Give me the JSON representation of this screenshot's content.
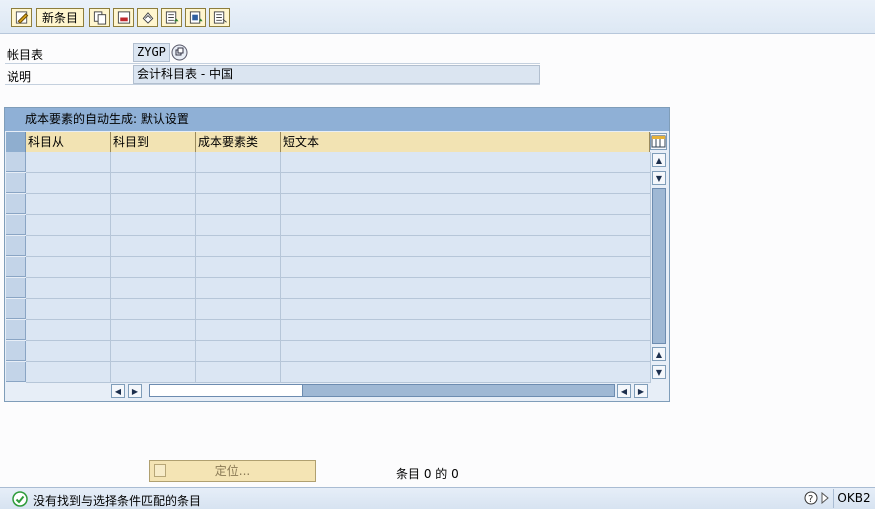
{
  "toolbar": {
    "new_entries_label": "新条目",
    "icons": [
      "edit-toggle-icon",
      "copy-icon",
      "delete-icon",
      "undo-icon",
      "select-all-icon",
      "select-block-icon",
      "deselect-all-icon"
    ]
  },
  "header": {
    "coa_label": "帐目表",
    "coa_value": "ZYGP",
    "desc_label": "说明",
    "desc_value": "会计科目表 - 中国"
  },
  "table": {
    "caption": "成本要素的自动生成: 默认设置",
    "columns": [
      "科目从",
      "科目到",
      "成本要素类",
      "短文本"
    ],
    "row_count": 11,
    "rows": []
  },
  "actions": {
    "position_label": "定位..."
  },
  "counter": "条目 0 的 0",
  "status": {
    "message": "没有找到与选择条件匹配的条目",
    "system": "OKB2"
  },
  "colors": {
    "header_bar": "#8fb0d6",
    "column_header": "#f2e3b3",
    "status_ok": "#2e9b3a"
  }
}
